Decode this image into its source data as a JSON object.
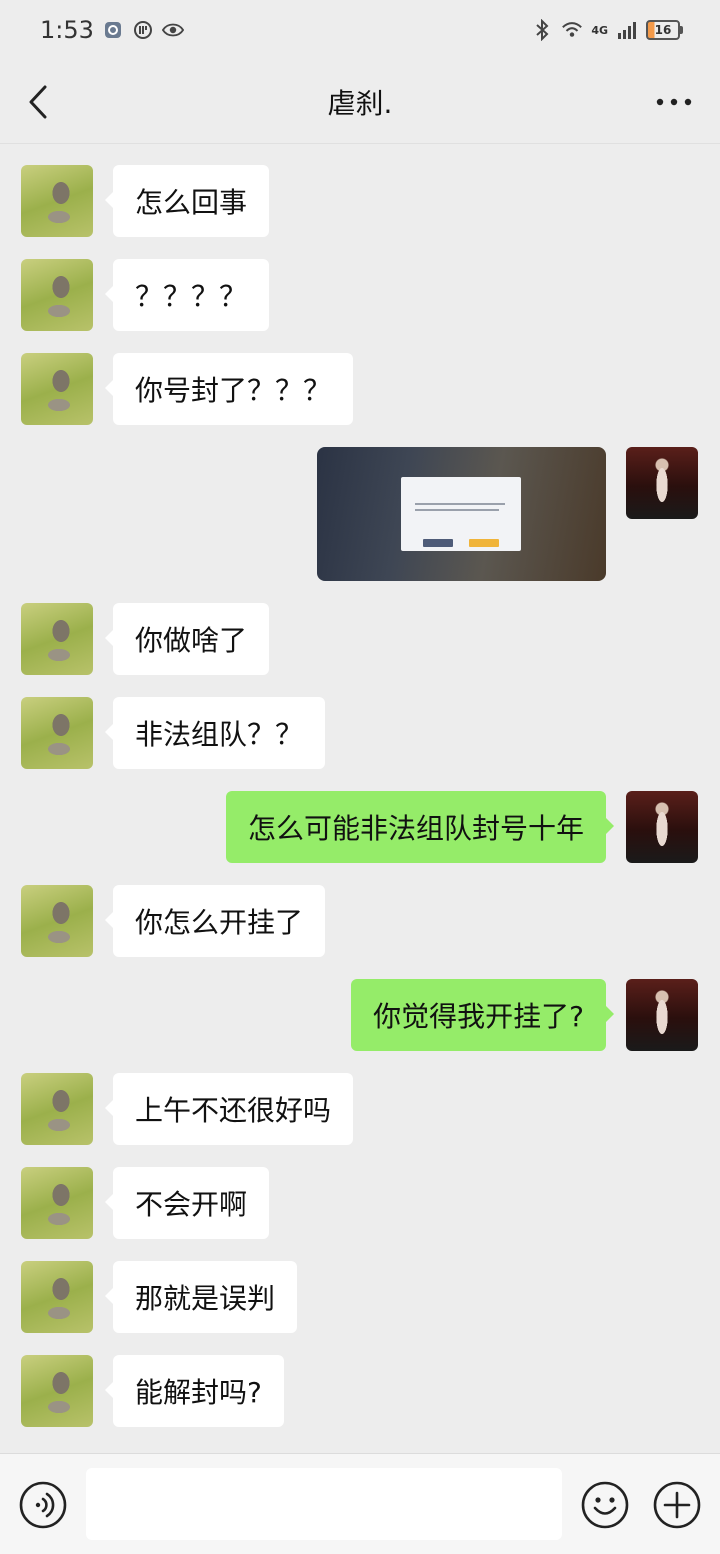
{
  "status_bar": {
    "time": "1:53",
    "network_label": "4G",
    "battery_level": "16"
  },
  "header": {
    "title": "虐刹."
  },
  "messages": [
    {
      "side": "left",
      "type": "text",
      "text": "怎么回事"
    },
    {
      "side": "left",
      "type": "text",
      "text": "？？？？"
    },
    {
      "side": "left",
      "type": "text",
      "text": "你号封了？？？"
    },
    {
      "side": "right",
      "type": "image",
      "text": ""
    },
    {
      "side": "left",
      "type": "text",
      "text": "你做啥了"
    },
    {
      "side": "left",
      "type": "text",
      "text": "非法组队？？"
    },
    {
      "side": "right",
      "type": "text",
      "text": "怎么可能非法组队封号十年"
    },
    {
      "side": "left",
      "type": "text",
      "text": "你怎么开挂了"
    },
    {
      "side": "right",
      "type": "text",
      "text": "你觉得我开挂了?"
    },
    {
      "side": "left",
      "type": "text",
      "text": "上午不还很好吗"
    },
    {
      "side": "left",
      "type": "text",
      "text": "不会开啊"
    },
    {
      "side": "left",
      "type": "text",
      "text": "那就是误判"
    },
    {
      "side": "left",
      "type": "text",
      "text": "能解封吗?"
    }
  ],
  "input_bar": {
    "placeholder": ""
  },
  "icons": {
    "back": "chevron-left-icon",
    "more": "more-icon",
    "voice": "voice-icon",
    "emoji": "emoji-icon",
    "plus": "plus-icon"
  },
  "colors": {
    "background": "#ededed",
    "bubble_left": "#ffffff",
    "bubble_right": "#95ec69"
  }
}
